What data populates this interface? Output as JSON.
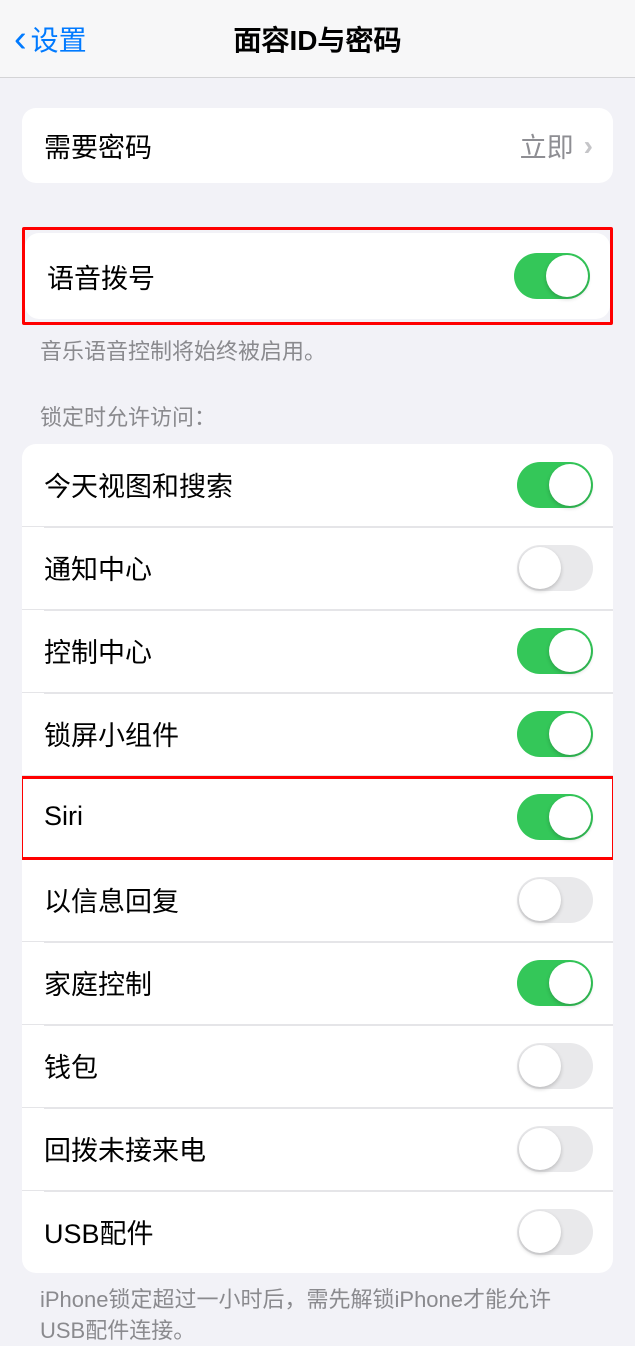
{
  "header": {
    "back_label": "设置",
    "title": "面容ID与密码"
  },
  "require_passcode": {
    "label": "需要密码",
    "value": "立即"
  },
  "voice_dial": {
    "label": "语音拨号",
    "enabled": true,
    "footer": "音乐语音控制将始终被启用。"
  },
  "lock_section": {
    "header": "锁定时允许访问：",
    "items": [
      {
        "label": "今天视图和搜索",
        "enabled": true
      },
      {
        "label": "通知中心",
        "enabled": false
      },
      {
        "label": "控制中心",
        "enabled": true
      },
      {
        "label": "锁屏小组件",
        "enabled": true
      },
      {
        "label": "Siri",
        "enabled": true
      },
      {
        "label": "以信息回复",
        "enabled": false
      },
      {
        "label": "家庭控制",
        "enabled": true
      },
      {
        "label": "钱包",
        "enabled": false
      },
      {
        "label": "回拨未接来电",
        "enabled": false
      },
      {
        "label": "USB配件",
        "enabled": false
      }
    ],
    "footer": "iPhone锁定超过一小时后，需先解锁iPhone才能允许USB配件连接。"
  }
}
